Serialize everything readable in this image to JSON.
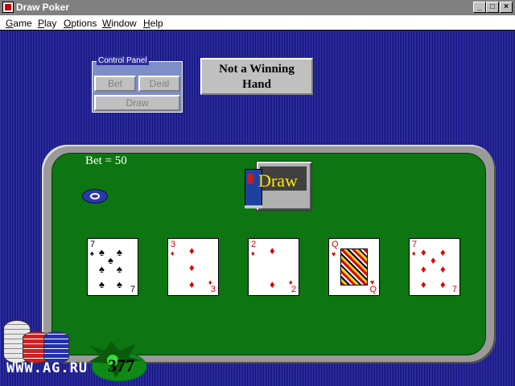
{
  "window": {
    "title": "Draw Poker"
  },
  "menu": [
    "Game",
    "Play",
    "Options",
    "Window",
    "Help"
  ],
  "control_panel": {
    "label": "Control Panel",
    "bet": "Bet",
    "deal": "Deal",
    "draw": "Draw"
  },
  "status": {
    "line1": "Not a Winning",
    "line2": "Hand"
  },
  "table": {
    "bet_label": "Bet = 50",
    "draw_label": "Draw"
  },
  "cards": [
    {
      "rank": "7",
      "suit": "♠",
      "color": "#000000"
    },
    {
      "rank": "3",
      "suit": "♦",
      "color": "#e00000"
    },
    {
      "rank": "2",
      "suit": "♦",
      "color": "#e00000"
    },
    {
      "rank": "Q",
      "suit": "♥",
      "color": "#e00000"
    },
    {
      "rank": "7",
      "suit": "♦",
      "color": "#e00000"
    }
  ],
  "watermark": "WWW.AG.RU",
  "dealer_number": "377"
}
